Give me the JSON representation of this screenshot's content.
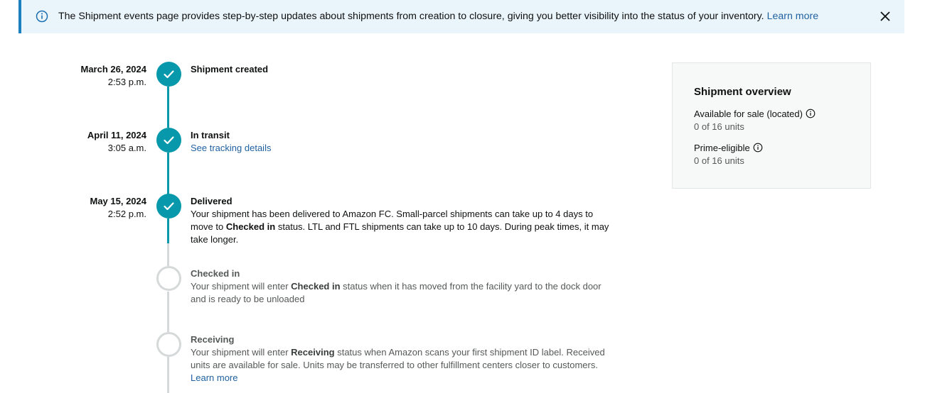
{
  "banner": {
    "message": "The Shipment events page provides step-by-step updates about shipments from creation to closure, giving you better visibility into the status of your inventory.",
    "link": "Learn more",
    "info_icon": "info-icon",
    "close_icon": "close-icon"
  },
  "timeline": [
    {
      "date": "March 26, 2024",
      "time": "2:53 p.m.",
      "title": "Shipment created",
      "status": "done"
    },
    {
      "date": "April 11, 2024",
      "time": "3:05 a.m.",
      "title": "In transit",
      "link": "See tracking details",
      "status": "done"
    },
    {
      "date": "May 15, 2024",
      "time": "2:52 p.m.",
      "title": "Delivered",
      "desc_a": "Your shipment has been delivered to Amazon FC. Small-parcel shipments can take up to 4 days to move to",
      "desc_bold": "Checked in",
      "desc_b": "status. LTL and FTL shipments can take up to 10 days. During peak times, it may take longer.",
      "status": "done"
    },
    {
      "title": "Checked in",
      "desc_a": "Your shipment will enter",
      "desc_bold": "Checked in",
      "desc_b": "status when it has moved from the facility yard to the dock door and is ready to be unloaded",
      "status": "pending"
    },
    {
      "title": "Receiving",
      "desc_a": "Your shipment will enter",
      "desc_bold": "Receiving",
      "desc_b": "status when Amazon scans your first shipment ID label. Received units are available for sale. Units may be transferred to other fulfillment centers closer to customers.",
      "link": "Learn more",
      "status": "pending"
    }
  ],
  "overview": {
    "title": "Shipment overview",
    "items": [
      {
        "label": "Available for sale (located)",
        "value": "0 of 16 units",
        "icon": "info-icon"
      },
      {
        "label": "Prime-eligible",
        "value": "0 of 16 units",
        "icon": "info-icon"
      }
    ]
  },
  "colors": {
    "accent": "#0799ab",
    "link": "#2162a1",
    "banner_bg": "#eaf4fb",
    "banner_border": "#1c7fbf",
    "pending": "#d5d9d9"
  }
}
